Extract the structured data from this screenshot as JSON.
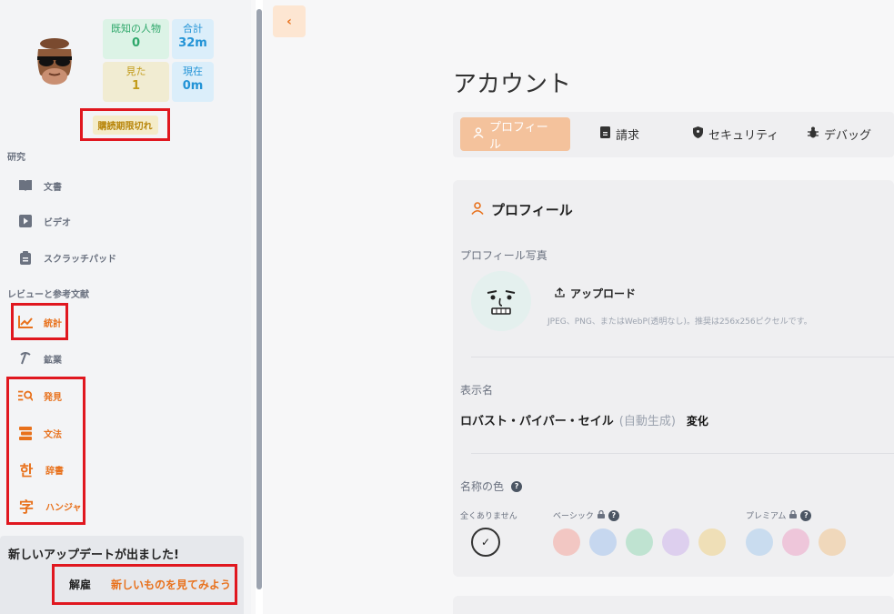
{
  "sidebar": {
    "stats": {
      "known_label": "既知の人物",
      "known_value": "0",
      "total_label": "合計",
      "total_value": "32m",
      "seen_label": "見た",
      "seen_value": "1",
      "now_label": "現在",
      "now_value": "0m"
    },
    "subscription_badge": "購読期限切れ",
    "sections": {
      "study": "研究",
      "review": "レビューと参考文献"
    },
    "nav": {
      "docs": "文書",
      "video": "ビデオ",
      "scratchpad": "スクラッチパッド",
      "stats": "統計",
      "mining": "鉱業",
      "discover": "発見",
      "grammar": "文法",
      "dictionary": "辞書",
      "dictionary_glyph": "한",
      "hanja": "ハンジャ",
      "hanja_glyph": "字"
    },
    "update": {
      "title": "新しいアップデートが出ました!",
      "dismiss": "解雇",
      "whats_new": "新しいものを見てみよう"
    }
  },
  "main": {
    "title": "アカウント",
    "tabs": [
      "プロフィール",
      "請求",
      "セキュリティ",
      "デバッグ"
    ],
    "profile": {
      "heading": "プロフィール",
      "photo_label": "プロフィール写真",
      "upload": "アップロード",
      "upload_hint": "JPEG、PNG、またはWebP(透明なし)。推奨は256x256ピクセルです。",
      "display_name_label": "表示名",
      "display_name": "ロバスト・パイパー・セイル",
      "display_name_auto": "(自動生成)",
      "display_name_change": "変化",
      "name_color_label": "名称の色",
      "color_none": "全くありません",
      "color_basic": "ベーシック",
      "color_premium": "プレミアム"
    }
  },
  "colors": {
    "accent": "#e8711c",
    "basic_swatches": [
      "#f2c7c3",
      "#c6d7ef",
      "#bfe3d1",
      "#ddcfee",
      "#efdfb7"
    ],
    "premium_swatches": [
      "#c9dcef",
      "#eec6da",
      "#f0d8bb"
    ]
  }
}
